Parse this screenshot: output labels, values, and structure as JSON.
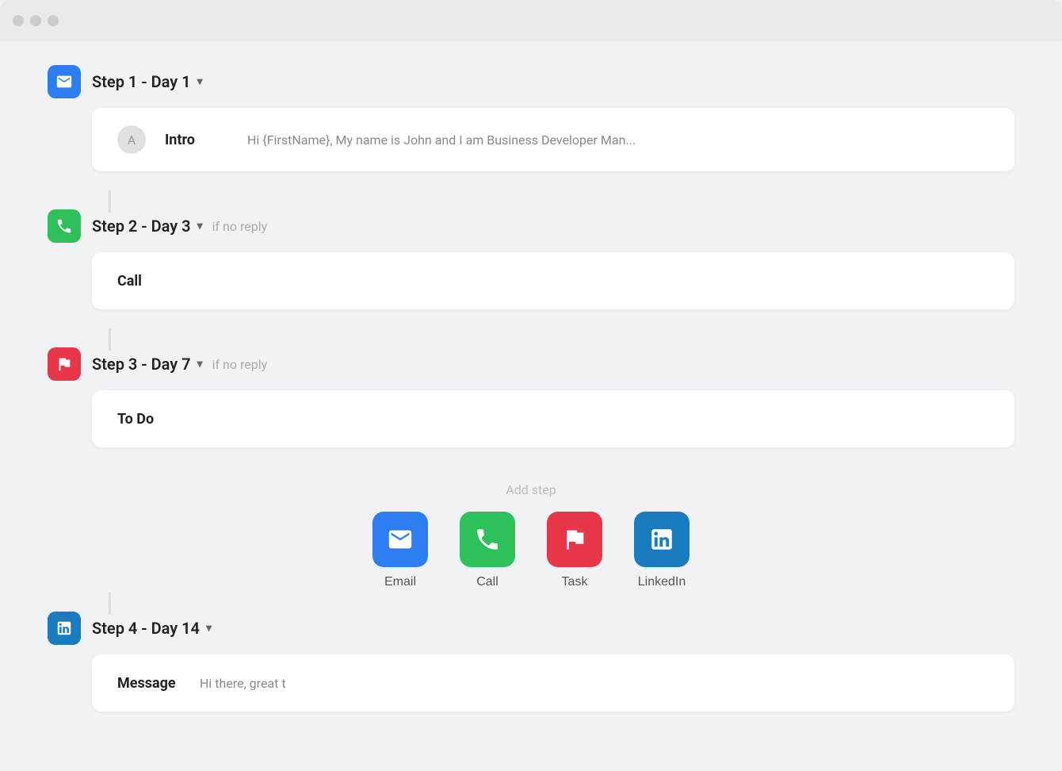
{
  "window": {
    "dots": [
      "dot1",
      "dot2",
      "dot3"
    ]
  },
  "steps": [
    {
      "id": "step1",
      "icon_type": "email",
      "title": "Step 1 - Day 1",
      "no_reply": "",
      "has_avatar": true,
      "body_label": "Intro",
      "body_preview": "Hi {FirstName},  My name is John and I am Business Developer Man...",
      "connector": true
    },
    {
      "id": "step2",
      "icon_type": "call",
      "title": "Step 2 - Day 3",
      "no_reply": "if no reply",
      "has_avatar": false,
      "body_label": "Call",
      "body_preview": "",
      "connector": true
    },
    {
      "id": "step3",
      "icon_type": "task",
      "title": "Step 3 - Day 7",
      "no_reply": "if no reply",
      "has_avatar": false,
      "body_label": "To Do",
      "body_preview": "",
      "connector": true
    },
    {
      "id": "step4",
      "icon_type": "linkedin",
      "title": "Step 4 - Day 14",
      "no_reply": "",
      "has_avatar": false,
      "body_label": "Message",
      "body_preview": "Hi there, great t",
      "connector": false
    }
  ],
  "add_step": {
    "label": "Add step",
    "buttons": [
      {
        "id": "btn-email",
        "type": "email-btn",
        "label": "Email"
      },
      {
        "id": "btn-call",
        "type": "call-btn",
        "label": "Call"
      },
      {
        "id": "btn-task",
        "type": "task-btn",
        "label": "Task"
      },
      {
        "id": "btn-linkedin",
        "type": "linkedin-btn",
        "label": "LinkedIn"
      }
    ]
  }
}
